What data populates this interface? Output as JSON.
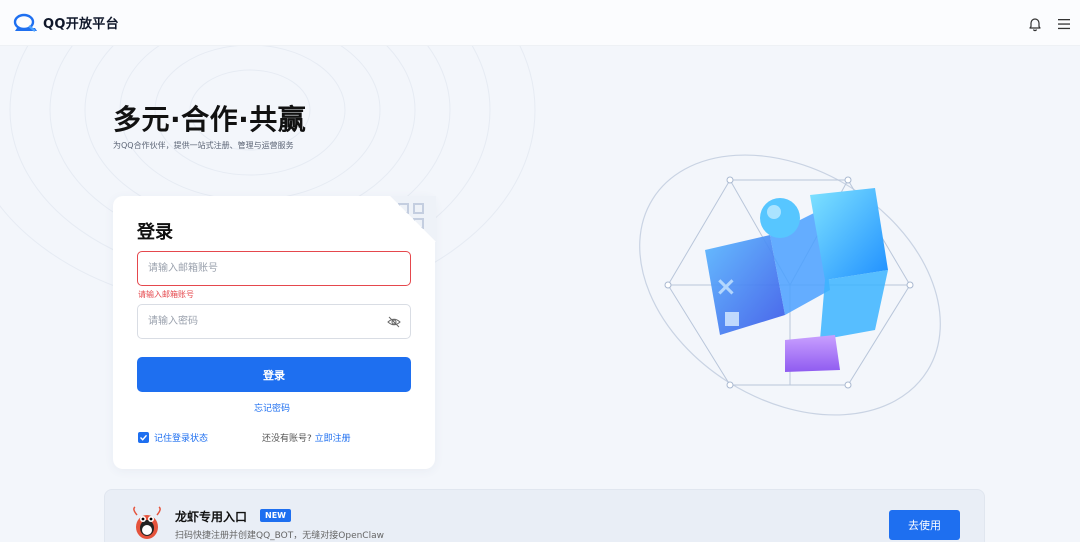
{
  "header": {
    "logo_text": "QQ开放平台",
    "icons": [
      "bell-icon",
      "menu-icon"
    ]
  },
  "hero": {
    "title": "多元·合作·共赢",
    "subtitle": "为QQ合作伙伴，提供一站式注册、管理与运营服务"
  },
  "login": {
    "title": "登录",
    "email_placeholder": "请输入邮箱账号",
    "email_value": "",
    "email_error": "请输入邮箱账号",
    "password_placeholder": "请输入密码",
    "password_value": "",
    "submit_label": "登录",
    "forgot_label": "忘记密码",
    "remember_label": "记住登录状态",
    "remember_checked": true,
    "no_account_text": "还没有账号?",
    "register_label": "立即注册"
  },
  "promo": {
    "title": "龙虾专用入口",
    "badge": "NEW",
    "description": "扫码快捷注册并创建QQ_BOT，无缝对接OpenClaw",
    "button_label": "去使用"
  },
  "colors": {
    "accent": "#1e6ff0",
    "error": "#e5484d",
    "background": "#f3f6fb"
  }
}
